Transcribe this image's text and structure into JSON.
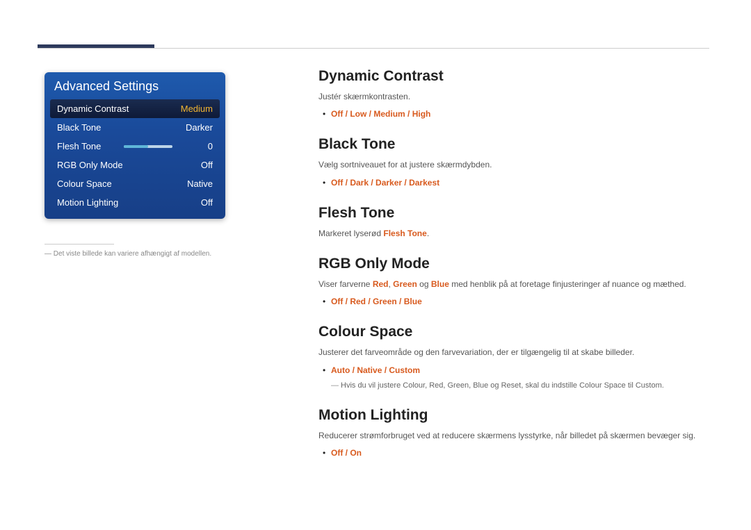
{
  "osd": {
    "title": "Advanced Settings",
    "rows": [
      {
        "label": "Dynamic Contrast",
        "value": "Medium",
        "selected": true
      },
      {
        "label": "Black Tone",
        "value": "Darker"
      },
      {
        "label": "Flesh Tone",
        "value": "0",
        "slider": true
      },
      {
        "label": "RGB Only Mode",
        "value": "Off"
      },
      {
        "label": "Colour Space",
        "value": "Native"
      },
      {
        "label": "Motion Lighting",
        "value": "Off"
      }
    ]
  },
  "footnote_left": "Det viste billede kan variere afhængigt af modellen.",
  "sections": {
    "dynamic_contrast": {
      "title": "Dynamic Contrast",
      "desc": "Justér skærmkontrasten.",
      "options": [
        "Off",
        "Low",
        "Medium",
        "High"
      ]
    },
    "black_tone": {
      "title": "Black Tone",
      "desc": "Vælg sortniveauet for at justere skærmdybden.",
      "options": [
        "Off",
        "Dark",
        "Darker",
        "Darkest"
      ]
    },
    "flesh_tone": {
      "title": "Flesh Tone",
      "desc_pre": "Markeret lyserød ",
      "desc_em": "Flesh Tone",
      "desc_post": "."
    },
    "rgb_only": {
      "title": "RGB Only Mode",
      "desc_pre": "Viser farverne ",
      "r": "Red",
      "g": "Green",
      "b": "Blue",
      "mid1": ", ",
      "mid2": " og ",
      "desc_post": " med henblik på at foretage finjusteringer af nuance og mæthed.",
      "options": [
        "Off",
        "Red",
        "Green",
        "Blue"
      ]
    },
    "colour_space": {
      "title": "Colour Space",
      "desc": "Justerer det farveområde og den farvevariation, der er tilgængelig til at skabe billeder.",
      "options": [
        "Auto",
        "Native",
        "Custom"
      ],
      "note_pre": "Hvis du vil justere ",
      "note_colour": "Colour",
      "note_r": "Red",
      "note_g": "Green",
      "note_b": "Blue",
      "note_reset": "Reset",
      "note_mid1": ", skal du indstille ",
      "note_cs": "Colour Space",
      "note_mid2": " til ",
      "note_custom": "Custom",
      "note_post": ".",
      "sep_comma": ", ",
      "sep_and": " og "
    },
    "motion_lighting": {
      "title": "Motion Lighting",
      "desc": "Reducerer strømforbruget ved at reducere skærmens lysstyrke, når billedet på skærmen bevæger sig.",
      "options": [
        "Off",
        "On"
      ]
    }
  }
}
